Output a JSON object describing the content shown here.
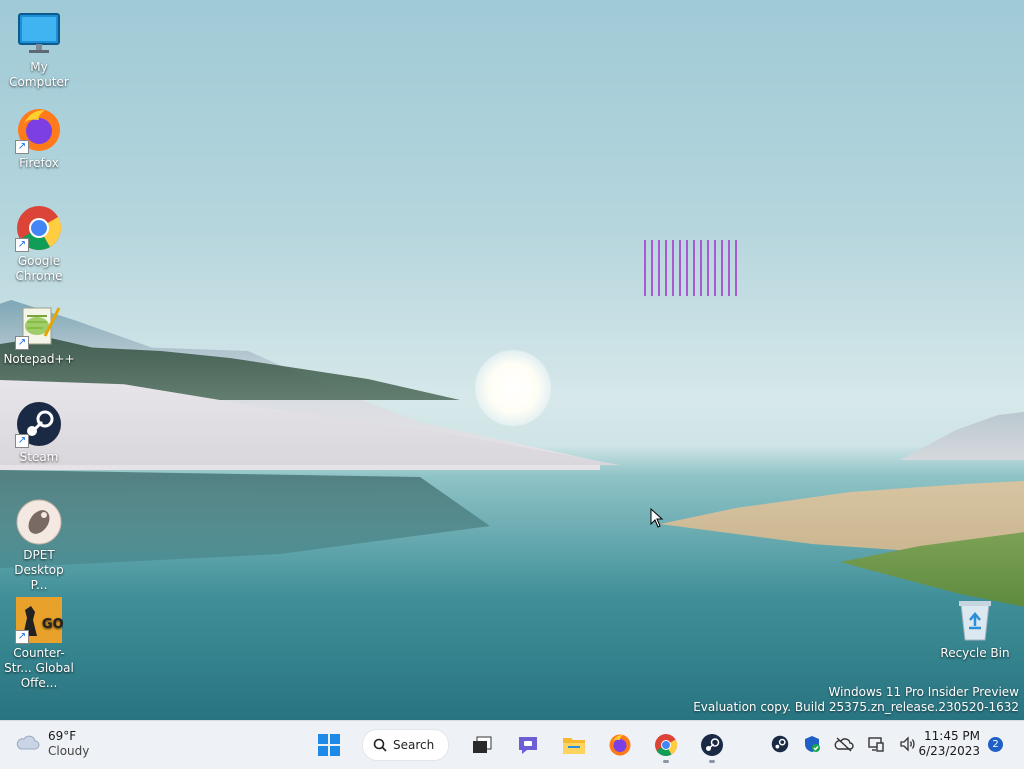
{
  "desktop": {
    "icons": [
      {
        "label": "My Computer",
        "icon": "monitor-icon"
      },
      {
        "label": "Firefox",
        "icon": "firefox-icon"
      },
      {
        "label": "Google Chrome",
        "icon": "chrome-icon"
      },
      {
        "label": "Notepad++",
        "icon": "notepadpp-icon"
      },
      {
        "label": "Steam",
        "icon": "steam-icon"
      },
      {
        "label": "DPET Desktop P...",
        "icon": "dpet-icon"
      },
      {
        "label": "Counter-Str... Global Offe...",
        "icon": "csgo-icon"
      }
    ],
    "recycle_bin": {
      "label": "Recycle Bin",
      "icon": "recycle-bin-icon"
    }
  },
  "watermark": {
    "line1": "Windows 11 Pro Insider Preview",
    "line2": "Evaluation copy. Build 25375.zn_release.230520-1632"
  },
  "taskbar": {
    "weather": {
      "temp": "69°F",
      "condition": "Cloudy"
    },
    "search_label": "Search",
    "apps": [
      "start-icon",
      "task-view-icon",
      "chat-icon",
      "file-explorer-icon",
      "firefox-icon",
      "chrome-icon",
      "steam-icon"
    ],
    "tray": [
      "steam-tray-icon",
      "security-icon",
      "onedrive-icon",
      "network-icon",
      "volume-icon"
    ],
    "clock": {
      "time": "11:45 PM",
      "date": "6/23/2023"
    },
    "notifications": "2"
  },
  "colors": {
    "taskbar_bg": "#eef1f5",
    "accent": "#1f5fc6",
    "glitch": "#a64bd1"
  }
}
